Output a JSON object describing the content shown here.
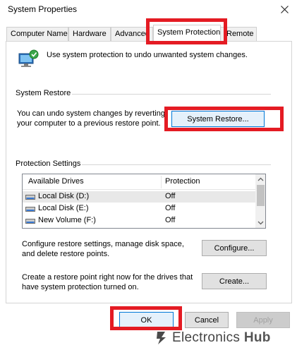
{
  "window": {
    "title": "System Properties"
  },
  "tabs": [
    {
      "label": "Computer Name",
      "active": false
    },
    {
      "label": "Hardware",
      "active": false
    },
    {
      "label": "Advanced",
      "active": false
    },
    {
      "label": "System Protection",
      "active": true
    },
    {
      "label": "Remote",
      "active": false
    }
  ],
  "intro": {
    "text": "Use system protection to undo unwanted system changes."
  },
  "system_restore": {
    "group_label": "System Restore",
    "description_line1": "You can undo system changes by reverting",
    "description_line2": "your computer to a previous restore point.",
    "button_label": "System Restore..."
  },
  "protection": {
    "group_label": "Protection Settings",
    "columns": [
      "Available Drives",
      "Protection"
    ],
    "rows": [
      {
        "drive": "Local Disk (D:)",
        "protection": "Off"
      },
      {
        "drive": "Local Disk (E:)",
        "protection": "Off"
      },
      {
        "drive": "New Volume (F:)",
        "protection": "Off"
      }
    ],
    "configure_text_line1": "Configure restore settings, manage disk space,",
    "configure_text_line2": "and delete restore points.",
    "configure_button": "Configure...",
    "create_text_line1": "Create a restore point right now for the drives that",
    "create_text_line2": "have system protection turned on.",
    "create_button": "Create..."
  },
  "footer": {
    "ok": "OK",
    "cancel": "Cancel",
    "apply": "Apply"
  },
  "watermark": {
    "brand_part1": "Electronics",
    "brand_part2": "Hub"
  },
  "colors": {
    "highlight": "#e41b23",
    "accent": "#0078d7"
  },
  "icons": {
    "close": "close-icon",
    "system": "computer-shield-icon",
    "drive": "drive-icon",
    "logo": "electronics-hub-logo-icon"
  }
}
